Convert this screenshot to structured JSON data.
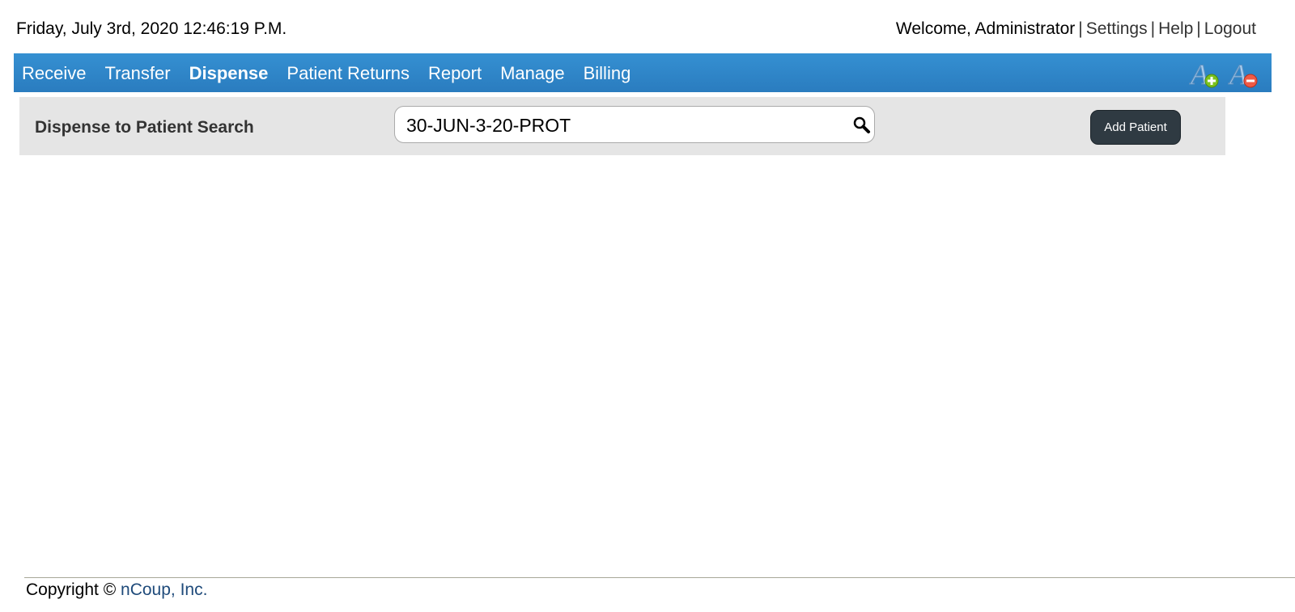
{
  "header": {
    "datetime": "Friday, July 3rd, 2020 12:46:19 P.M.",
    "welcome": "Welcome, Administrator",
    "separator": "|",
    "settings": "Settings",
    "help": "Help",
    "logout": "Logout"
  },
  "nav": {
    "items": [
      "Receive",
      "Transfer",
      "Dispense",
      "Patient Returns",
      "Report",
      "Manage",
      "Billing"
    ],
    "active": "Dispense",
    "icons": [
      "font-size-increase-icon",
      "font-size-decrease-icon"
    ],
    "color": "#2f86c9"
  },
  "panel": {
    "title": "Dispense to Patient Search",
    "search_value": "30-JUN-3-20-PROT",
    "add_patient": "Add Patient"
  },
  "footer": {
    "copyright": "Copyright ©",
    "company": "nCoup, Inc."
  }
}
